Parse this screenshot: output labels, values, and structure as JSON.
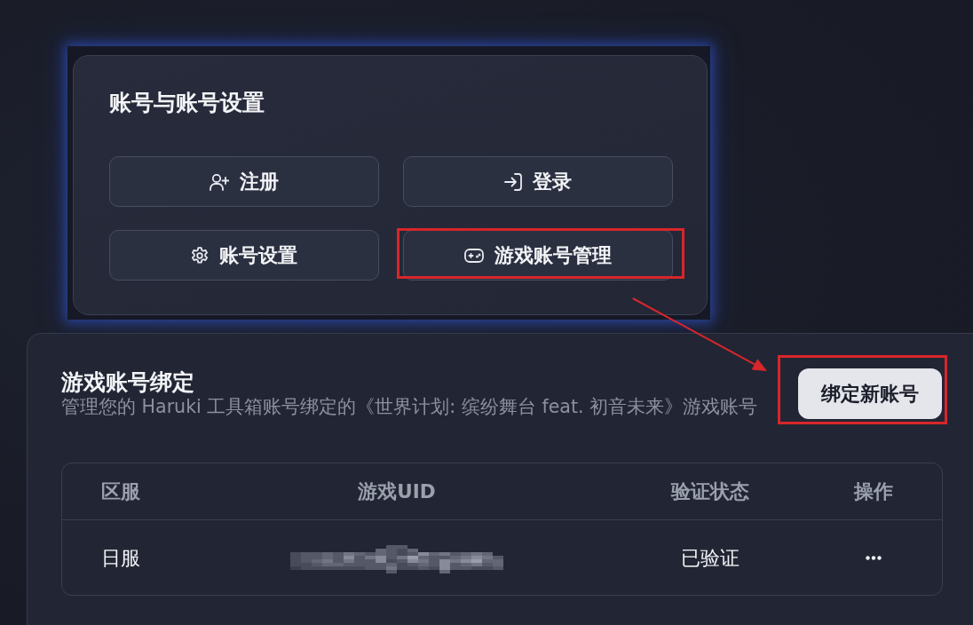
{
  "account_card": {
    "title": "账号与账号设置",
    "buttons": [
      {
        "label": "注册",
        "highlighted": false
      },
      {
        "label": "登录",
        "highlighted": false
      },
      {
        "label": "账号设置",
        "highlighted": false
      },
      {
        "label": "游戏账号管理",
        "highlighted": true
      }
    ]
  },
  "binding_card": {
    "title": "游戏账号绑定",
    "description": "管理您的 Haruki 工具箱账号绑定的《世界计划: 缤纷舞台 feat. 初音未来》游戏账号",
    "bind_button": {
      "label": "绑定新账号",
      "highlighted": true
    },
    "table": {
      "columns": [
        "区服",
        "游戏UID",
        "验证状态",
        "操作"
      ],
      "rows": [
        {
          "cells": [
            {
              "kind": "text",
              "text": "日服"
            },
            {
              "kind": "pixelated"
            },
            {
              "kind": "text",
              "text": "已验证"
            },
            {
              "kind": "menu"
            }
          ]
        }
      ]
    }
  }
}
